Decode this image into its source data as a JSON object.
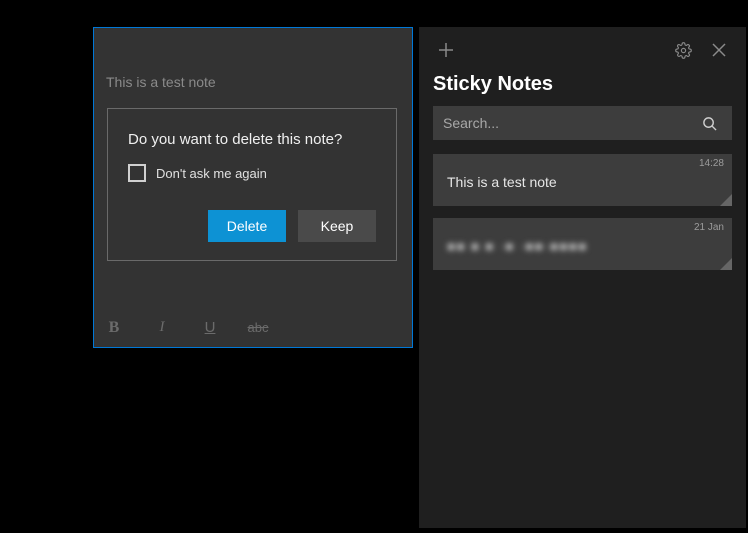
{
  "note_editor": {
    "content": "This is a test note",
    "toolbar": {
      "bold": "B",
      "italic": "I",
      "underline": "U",
      "strike": "abc"
    }
  },
  "delete_modal": {
    "title": "Do you want to delete this note?",
    "checkbox_label": "Don't ask me again",
    "delete_label": "Delete",
    "keep_label": "Keep"
  },
  "sidebar": {
    "title": "Sticky Notes",
    "search_placeholder": "Search...",
    "notes": [
      {
        "preview": "This is a test note",
        "time": "14:28"
      },
      {
        "preview": "■■ ■ ■ ·■  ·■■·■■■■",
        "time": "21 Jan"
      }
    ]
  }
}
